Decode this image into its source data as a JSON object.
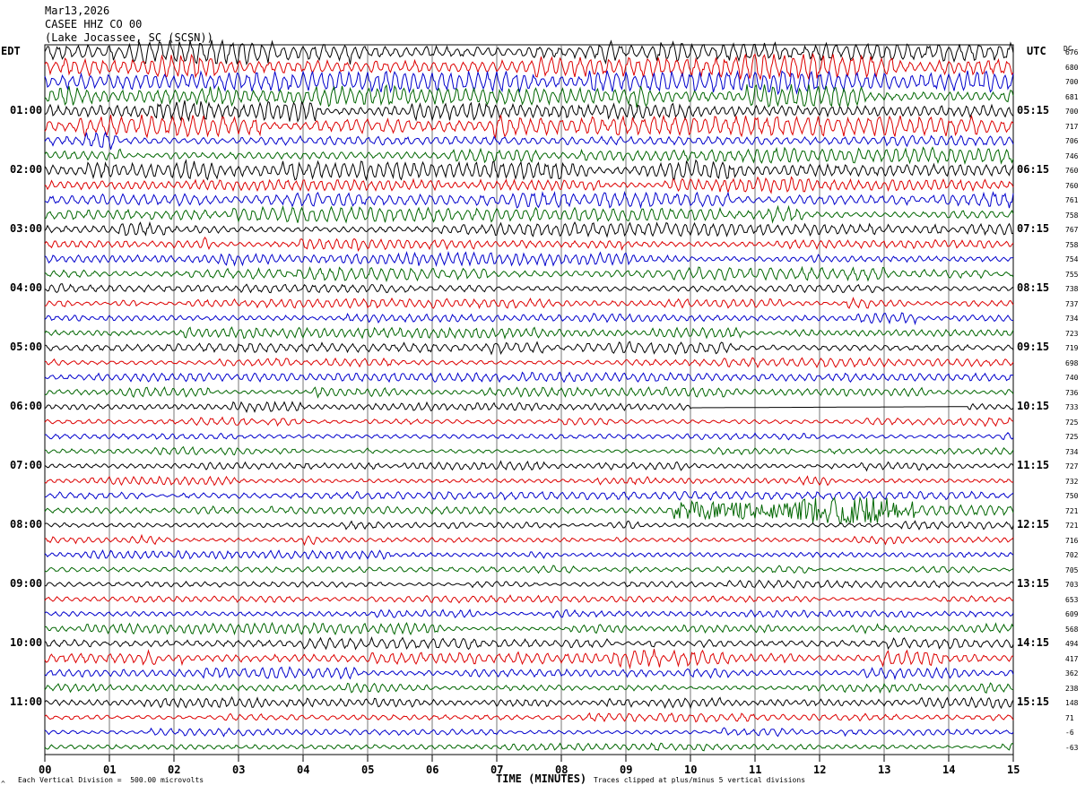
{
  "header": {
    "date": "Mar13,2026",
    "station": "CASEE HHZ CO 00",
    "location": "(Lake Jocassee, SC (SCSN))"
  },
  "left_zone": "EDT",
  "right_zone": "UTC",
  "dc_label": "DC",
  "footer": {
    "scale_note": "Each Vertical Division =  500.00 microvolts",
    "clip_note": "Traces clipped at plus/minus 5 vertical divisions",
    "corner_mark": "^"
  },
  "colors": {
    "trace_cycle": [
      "#000000",
      "#dd0000",
      "#0000cc",
      "#006600"
    ],
    "grid": "#777777"
  },
  "chart_data": {
    "type": "line",
    "title": "Mar13,2026 CASEE HHZ CO 00 (Lake Jocassee, SC (SCSN))",
    "xlabel": "TIME (MINUTES)",
    "ylabel": "",
    "xlim": [
      0,
      15
    ],
    "x_ticks": [
      "00",
      "01",
      "02",
      "03",
      "04",
      "05",
      "06",
      "07",
      "08",
      "09",
      "10",
      "11",
      "12",
      "13",
      "14",
      "15"
    ],
    "left_hour_labels": [
      "01:00",
      "02:00",
      "03:00",
      "04:00",
      "05:00",
      "06:00",
      "07:00",
      "08:00",
      "09:00",
      "10:00",
      "11:00"
    ],
    "right_hour_labels": [
      "05:15",
      "06:15",
      "07:15",
      "08:15",
      "09:15",
      "10:15",
      "11:15",
      "12:15",
      "13:15",
      "14:15",
      "15:15"
    ],
    "dc_offsets": [
      676,
      680,
      700,
      681,
      700,
      717,
      706,
      746,
      760,
      760,
      761,
      758,
      767,
      758,
      754,
      755,
      738,
      737,
      734,
      723,
      719,
      698,
      740,
      736,
      733,
      725,
      725,
      734,
      727,
      732,
      750,
      721,
      721,
      716,
      702,
      705,
      703,
      653,
      609,
      568,
      494,
      417,
      362,
      238,
      148,
      71,
      -6,
      -63
    ],
    "series": [
      {
        "values": [
          1.6
        ]
      },
      {
        "values": [
          1.5
        ]
      },
      {
        "values": [
          1.6
        ]
      },
      {
        "values": [
          1.3
        ]
      },
      {
        "values": [
          1.3
        ]
      },
      {
        "values": [
          1.2
        ]
      },
      {
        "values": [
          1.0
        ]
      },
      {
        "values": [
          1.0
        ]
      },
      {
        "values": [
          1.1
        ]
      },
      {
        "values": [
          0.9
        ]
      },
      {
        "values": [
          0.9
        ]
      },
      {
        "values": [
          0.9
        ]
      },
      {
        "values": [
          0.8
        ]
      },
      {
        "values": [
          0.8
        ]
      },
      {
        "values": [
          0.8
        ]
      },
      {
        "values": [
          0.8
        ]
      },
      {
        "values": [
          0.6
        ]
      },
      {
        "values": [
          0.6
        ]
      },
      {
        "values": [
          0.6
        ]
      },
      {
        "values": [
          0.6
        ]
      },
      {
        "values": [
          0.7
        ]
      },
      {
        "values": [
          0.7
        ]
      },
      {
        "values": [
          0.6
        ]
      },
      {
        "values": [
          0.6
        ]
      },
      {
        "values": [
          0.6
        ]
      },
      {
        "values": [
          0.5
        ]
      },
      {
        "values": [
          0.5
        ]
      },
      {
        "values": [
          0.5
        ]
      },
      {
        "values": [
          0.5
        ]
      },
      {
        "values": [
          0.5
        ]
      },
      {
        "values": [
          0.5
        ]
      },
      {
        "values": [
          0.6
        ]
      },
      {
        "values": [
          0.5
        ]
      },
      {
        "values": [
          0.5
        ]
      },
      {
        "values": [
          0.5
        ]
      },
      {
        "values": [
          0.5
        ]
      },
      {
        "values": [
          0.5
        ]
      },
      {
        "values": [
          0.5
        ]
      },
      {
        "values": [
          0.5
        ]
      },
      {
        "values": [
          0.6
        ]
      },
      {
        "values": [
          0.7
        ]
      },
      {
        "values": [
          1.0
        ]
      },
      {
        "values": [
          0.7
        ]
      },
      {
        "values": [
          0.6
        ]
      },
      {
        "values": [
          0.6
        ]
      },
      {
        "values": [
          0.5
        ]
      },
      {
        "values": [
          0.5
        ]
      },
      {
        "values": [
          0.5
        ]
      }
    ],
    "grid": true
  }
}
